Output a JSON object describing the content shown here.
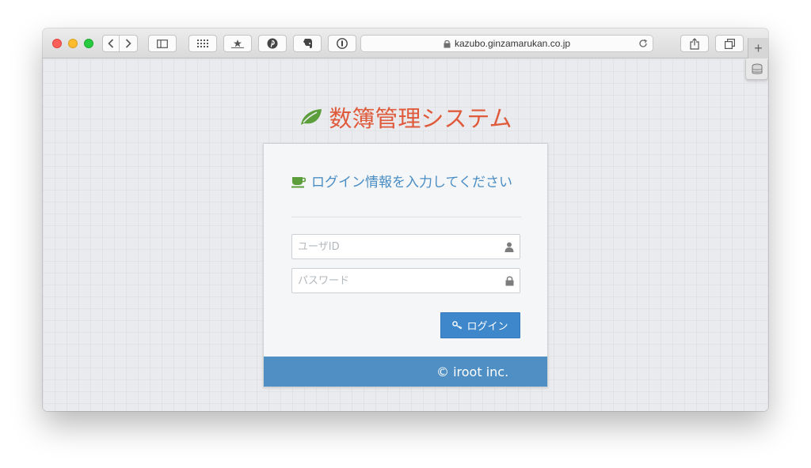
{
  "browser": {
    "url": "kazubo.ginzamarukan.co.jp",
    "new_tab_label": "+",
    "icons": [
      "back-icon",
      "forward-icon",
      "sidebar-icon",
      "top-sites-icon",
      "reader-icon",
      "pinterest-icon",
      "evernote-icon",
      "onepassword-icon",
      "lock-icon",
      "reload-icon",
      "share-icon",
      "tabs-icon",
      "extension-icon"
    ]
  },
  "page": {
    "brand_title": "数簿管理システム",
    "brand_color": "#e05a3c",
    "heading": "ログイン情報を入力してください",
    "username_placeholder": "ユーザID",
    "password_placeholder": "パスワード",
    "login_label": "ログイン",
    "footer_text": "© iroot inc.",
    "accent_color": "#3e87cb"
  }
}
